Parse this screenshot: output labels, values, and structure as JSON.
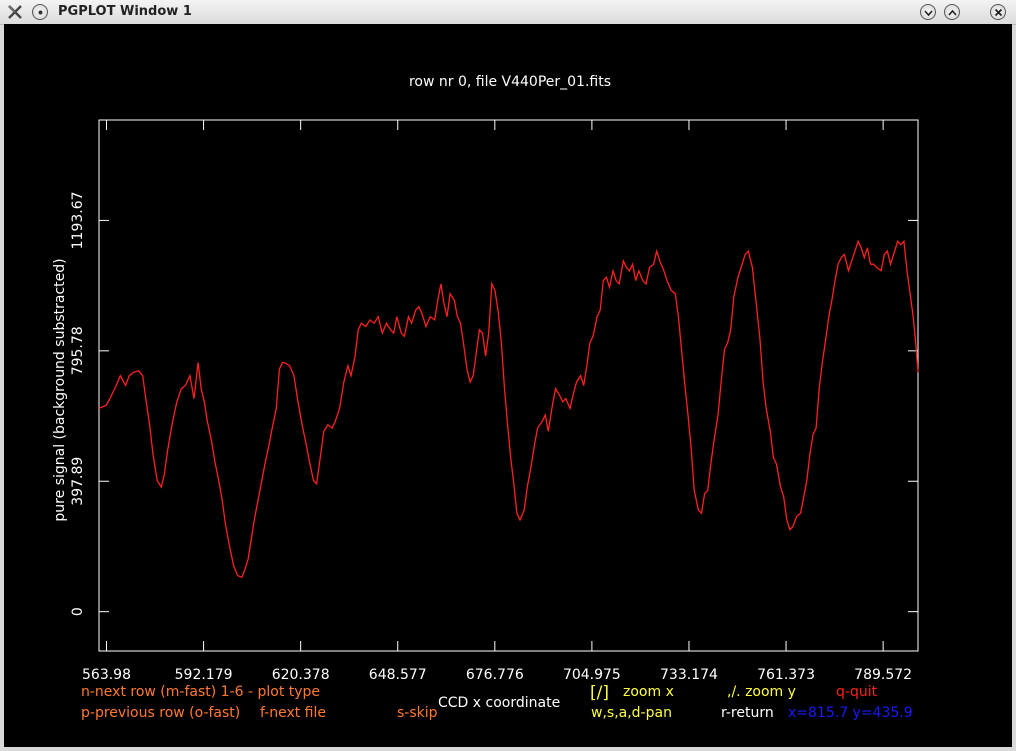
{
  "window": {
    "title": "PGPLOT Window 1",
    "app_icon": "x-icon",
    "buttons": [
      "menu-icon",
      "minimize-icon",
      "maximize-icon",
      "close-icon"
    ]
  },
  "plot": {
    "title": "row nr 0, file V440Per_01.fits",
    "xlabel": "CCD x coordinate",
    "ylabel": "pure signal (background substracted)",
    "x_ticks": [
      "563.98",
      "592.179",
      "620.378",
      "648.577",
      "676.776",
      "704.975",
      "733.174",
      "761.373",
      "789.572"
    ],
    "y_ticks": [
      "0",
      "397.89",
      "795.78",
      "1193.67"
    ],
    "colors": {
      "background": "#000000",
      "axes": "#ffffff",
      "curve": "#ff2020",
      "help_orange": "#ff7a30",
      "help_yellow": "#ffff40",
      "help_red": "#ff2020",
      "coords": "#1a1aff"
    }
  },
  "help": {
    "next_row": "n-next row (m-fast) 1-6 - plot type",
    "prev_row": "p-previous row (o-fast)",
    "next_file": "f-next file",
    "skip": "s-skip",
    "zoom_x_key": "[/]",
    "zoom_x": "zoom x",
    "zoom_y": ",/. zoom y",
    "quit": "q-quit",
    "pan": "w,s,a,d-pan",
    "return": "r-return",
    "cursor": "x=815.7 y=435.9"
  },
  "chart_data": {
    "type": "line",
    "title": "row nr 0, file V440Per_01.fits",
    "xlabel": "CCD x coordinate",
    "ylabel": "pure signal (background substracted)",
    "xlim": [
      561.8,
      799.7
    ],
    "ylim": [
      -120,
      1500
    ],
    "x": [
      561.8,
      563.9,
      565.0,
      566.8,
      568.0,
      569.5,
      570.6,
      571.8,
      573.3,
      574.5,
      575.4,
      576.6,
      577.5,
      578.7,
      579.9,
      580.8,
      581.7,
      583.0,
      584.4,
      585.7,
      586.9,
      588.2,
      589.4,
      590.6,
      591.5,
      592.4,
      593.3,
      594.5,
      595.4,
      596.6,
      597.6,
      598.5,
      599.7,
      600.9,
      602.1,
      603.3,
      604.2,
      605.1,
      606.0,
      606.9,
      608.2,
      609.1,
      610.0,
      611.2,
      612.1,
      613.3,
      614.2,
      615.1,
      615.7,
      617.2,
      618.4,
      619.6,
      620.8,
      622.0,
      622.9,
      624.1,
      625.0,
      626.2,
      627.1,
      628.3,
      629.5,
      630.4,
      631.7,
      632.9,
      634.1,
      635.0,
      636.2,
      637.1,
      638.0,
      639.3,
      640.5,
      641.7,
      642.9,
      644.1,
      645.3,
      646.5,
      647.4,
      648.3,
      649.6,
      650.5,
      651.7,
      652.6,
      653.8,
      654.7,
      655.6,
      656.8,
      658.0,
      659.3,
      660.2,
      661.1,
      662.0,
      662.9,
      663.8,
      665.0,
      665.9,
      666.8,
      667.8,
      668.7,
      669.6,
      670.5,
      671.4,
      672.3,
      673.2,
      674.1,
      675.0,
      675.9,
      676.8,
      677.7,
      678.7,
      679.6,
      680.5,
      681.4,
      682.3,
      683.2,
      684.1,
      685.3,
      686.2,
      687.4,
      688.3,
      689.2,
      690.5,
      691.4,
      692.3,
      693.5,
      694.4,
      695.6,
      696.5,
      697.4,
      698.6,
      699.5,
      700.5,
      701.7,
      702.6,
      703.5,
      704.4,
      705.3,
      706.5,
      707.4,
      708.3,
      709.2,
      710.1,
      711.1,
      712.0,
      712.9,
      714.1,
      715.0,
      715.9,
      716.8,
      717.7,
      718.6,
      719.8,
      720.7,
      721.7,
      722.9,
      723.8,
      724.7,
      725.9,
      726.8,
      728.0,
      729.2,
      730.1,
      731.0,
      731.9,
      732.9,
      733.8,
      734.7,
      735.9,
      736.8,
      737.7,
      738.6,
      739.5,
      740.4,
      741.6,
      742.5,
      743.5,
      744.4,
      745.3,
      746.2,
      747.4,
      748.6,
      749.5,
      750.4,
      751.6,
      752.6,
      753.8,
      754.7,
      755.6,
      756.8,
      757.7,
      758.6,
      759.8,
      760.7,
      761.6,
      762.5,
      763.4,
      764.4,
      765.6,
      766.5,
      767.4,
      768.3,
      769.2,
      770.1,
      771.0,
      771.9,
      772.9,
      773.8,
      774.7,
      775.6,
      776.5,
      777.4,
      778.3,
      779.5,
      780.4,
      781.4,
      782.3,
      783.2,
      784.1,
      785.0,
      785.9,
      786.8,
      787.7,
      789.0,
      789.9,
      790.8,
      791.7,
      792.6,
      793.8,
      794.7,
      795.6,
      796.5,
      797.4,
      798.3,
      799.2,
      799.7
    ],
    "y": [
      620,
      630,
      650,
      690,
      720,
      690,
      720,
      730,
      735,
      720,
      650,
      560,
      480,
      400,
      380,
      420,
      490,
      570,
      640,
      680,
      690,
      720,
      650,
      760,
      680,
      640,
      580,
      520,
      460,
      400,
      340,
      270,
      200,
      140,
      110,
      105,
      130,
      160,
      220,
      280,
      350,
      400,
      450,
      510,
      560,
      620,
      740,
      760,
      760,
      750,
      720,
      640,
      570,
      510,
      460,
      400,
      390,
      480,
      550,
      570,
      560,
      580,
      620,
      700,
      750,
      720,
      780,
      860,
      880,
      870,
      890,
      880,
      900,
      850,
      880,
      860,
      850,
      900,
      850,
      840,
      900,
      880,
      920,
      930,
      910,
      870,
      900,
      890,
      950,
      1000,
      940,
      900,
      970,
      950,
      900,
      880,
      810,
      740,
      700,
      720,
      790,
      860,
      850,
      780,
      850,
      1000,
      980,
      920,
      820,
      680,
      570,
      470,
      390,
      300,
      280,
      310,
      380,
      450,
      510,
      560,
      580,
      600,
      550,
      630,
      680,
      660,
      640,
      650,
      620,
      660,
      700,
      720,
      690,
      750,
      820,
      840,
      900,
      920,
      1010,
      1020,
      990,
      1040,
      1010,
      1000,
      1070,
      1050,
      1040,
      1060,
      1010,
      1040,
      1010,
      1000,
      1050,
      1060,
      1100,
      1070,
      1040,
      1010,
      980,
      970,
      900,
      800,
      700,
      600,
      500,
      370,
      310,
      300,
      360,
      370,
      450,
      520,
      600,
      700,
      800,
      820,
      860,
      960,
      1020,
      1060,
      1090,
      1100,
      1050,
      950,
      830,
      700,
      620,
      550,
      470,
      450,
      380,
      350,
      280,
      250,
      260,
      290,
      300,
      350,
      400,
      480,
      540,
      560,
      680,
      760,
      830,
      900,
      950,
      1010,
      1060,
      1080,
      1090,
      1040,
      1070,
      1100,
      1130,
      1110,
      1080,
      1110,
      1060,
      1060,
      1050,
      1040,
      1090,
      1100,
      1060,
      1090,
      1130,
      1120,
      1130,
      1040,
      970,
      900,
      800,
      730,
      700,
      690,
      740,
      820,
      900,
      950,
      990,
      980,
      1040,
      1000,
      970,
      880
    ]
  }
}
